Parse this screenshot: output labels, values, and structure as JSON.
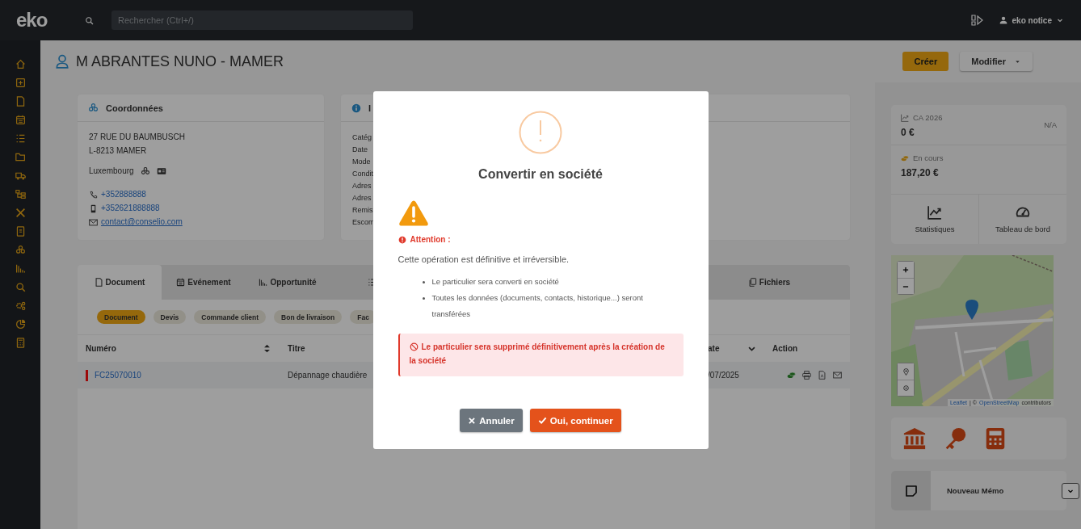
{
  "topbar": {
    "logo": "eko",
    "search": {
      "placeholder": "Rechercher (Ctrl+/)"
    },
    "user": "eko notice"
  },
  "header": {
    "title": "M ABRANTES NUNO - MAMER",
    "buttons": [
      {
        "label": "Créer",
        "kind": "primary"
      },
      {
        "label": "Modifier",
        "kind": "dropdown"
      }
    ]
  },
  "contact_card": {
    "title": "Coordonnées",
    "address": [
      "27 RUE DU BAUMBUSCH",
      "L-8213 MAMER"
    ],
    "country": "Luxembourg",
    "phone": "+352888888",
    "mobile": "+352621888888",
    "email": "contact@conselio.com"
  },
  "info_card": {
    "title": "I",
    "labels": [
      "Catég",
      "Date",
      "Mode",
      "Condit",
      "Adres",
      "Adres",
      "Remis",
      "Escom"
    ]
  },
  "tabs": [
    {
      "label": "Document",
      "selected": true
    },
    {
      "label": "Evénement",
      "selected": false
    },
    {
      "label": "Opportunité",
      "selected": false
    },
    {
      "selected": false
    },
    {
      "label": "Fichiers",
      "selected": false
    }
  ],
  "chips": [
    {
      "label": "Document",
      "selected": true
    },
    {
      "label": "Devis",
      "selected": false
    },
    {
      "label": "Commande client",
      "selected": false
    },
    {
      "label": "Bon de livraison",
      "selected": false
    },
    {
      "label": "Fac",
      "selected": false
    }
  ],
  "table": {
    "columns": [
      {
        "label": "Numéro",
        "kind": "sortable"
      },
      {
        "label": "Titre",
        "kind": "plain"
      },
      {
        "label": "ate",
        "kind": "sorted"
      },
      {
        "label": "Action",
        "kind": "plain"
      }
    ],
    "rows": [
      {
        "number": "FC25070010",
        "title": "Dépannage chaudière",
        "date": "/07/2025",
        "color": "#9c0a0a"
      }
    ]
  },
  "modal": {
    "title": "Convertir en société",
    "warning_label": "Attention :",
    "message": "Cette opération est définitive et irréversible.",
    "bullets": [
      "Le particulier sera converti en société",
      "Toutes les données (documents, contacts, historique...) seront transférées"
    ],
    "alert": "Le particulier sera supprimé définitivement après la création de la société",
    "buttons": [
      {
        "label": "Annuler",
        "kind": "cancel"
      },
      {
        "label": "Oui, continuer",
        "kind": "confirm"
      }
    ]
  },
  "summary": {
    "revenue": {
      "label": "CA 2026",
      "value": "0 €",
      "note": "N/A"
    },
    "pending": {
      "label": "En cours",
      "value": "187,20 €"
    },
    "links": [
      "Statistiques",
      "Tableau de bord"
    ]
  },
  "map": {
    "kind": "picture",
    "attribution": {
      "library": "Leaflet",
      "separator": "| ©",
      "source": "OpenStreetMap",
      "suffix": "contributors"
    }
  },
  "memo": {
    "label": "Nouveau Mémo"
  }
}
